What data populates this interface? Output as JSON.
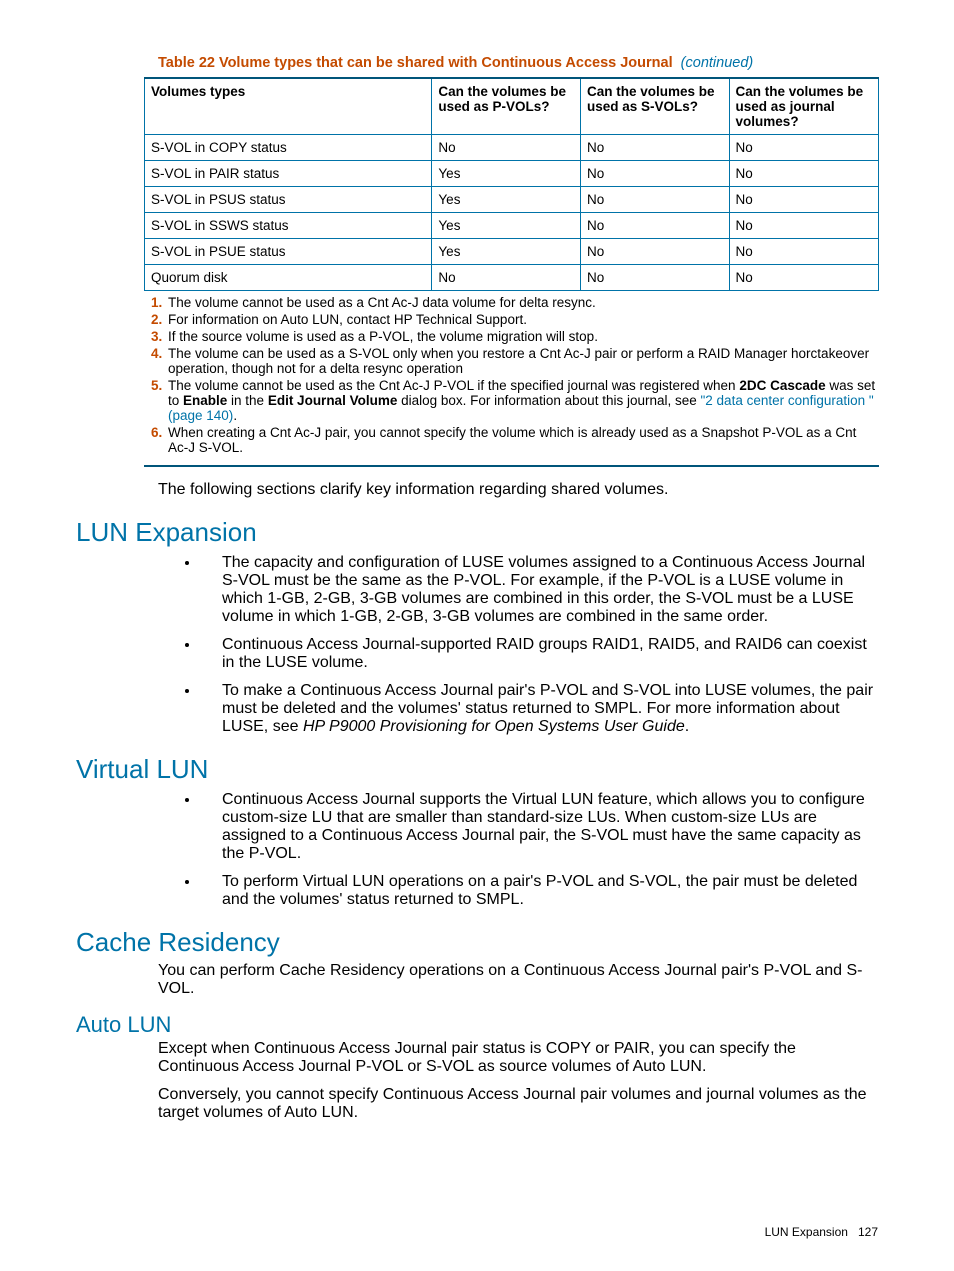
{
  "table": {
    "caption_prefix": "Table 22 Volume types that can be shared with Continuous Access Journal",
    "caption_suffix": "(continued)",
    "headers": [
      "Volumes types",
      "Can the volumes be used as P-VOLs?",
      "Can the volumes be used as S-VOLs?",
      "Can the volumes be used as journal volumes?"
    ],
    "rows": [
      [
        "S-VOL in COPY status",
        "No",
        "No",
        "No"
      ],
      [
        "S-VOL in PAIR status",
        "Yes",
        "No",
        "No"
      ],
      [
        "S-VOL in PSUS status",
        "Yes",
        "No",
        "No"
      ],
      [
        "S-VOL in SSWS status",
        "Yes",
        "No",
        "No"
      ],
      [
        "S-VOL in PSUE status",
        "Yes",
        "No",
        "No"
      ],
      [
        "Quorum disk",
        "No",
        "No",
        "No"
      ]
    ]
  },
  "footnotes": {
    "n1": "The volume cannot be used as a Cnt Ac-J data volume for delta resync.",
    "n2": "For information on Auto LUN, contact HP Technical Support.",
    "n3": "If the source volume is used as a P-VOL, the volume migration will stop.",
    "n4": "The volume can be used as a S-VOL only when you restore a Cnt Ac-J pair or perform a RAID Manager horctakeover operation, though not for a delta resync operation",
    "n5_a": "The volume cannot be used as the Cnt Ac-J P-VOL if the specified journal was registered when ",
    "n5_b": "2DC Cascade",
    "n5_c": " was set to ",
    "n5_d": "Enable",
    "n5_e": " in the ",
    "n5_f": "Edit Journal Volume",
    "n5_g": " dialog box. For information about this journal, see ",
    "n5_link": "\"2 data center configuration \" (page 140)",
    "n5_h": ".",
    "n6": "When creating a Cnt Ac-J pair, you cannot specify the volume which is already used as a Snapshot P-VOL as a Cnt Ac-J S-VOL."
  },
  "intro_p": "The following sections clarify key information regarding shared volumes.",
  "sections": {
    "lun_expansion": {
      "title": "LUN Expansion",
      "b1": "The capacity and configuration of LUSE volumes assigned to a Continuous Access Journal S-VOL must be the same as the P-VOL. For example, if the P-VOL is a LUSE volume in which 1-GB, 2-GB, 3-GB volumes are combined in this order, the S-VOL must be a LUSE volume in which 1-GB, 2-GB, 3-GB volumes are combined in the same order.",
      "b2": "Continuous Access Journal-supported RAID groups RAID1, RAID5, and RAID6 can coexist in the LUSE volume.",
      "b3_a": "To make a Continuous Access Journal pair's P-VOL and S-VOL into LUSE volumes, the pair must be deleted and the volumes' status returned to SMPL. For more information about LUSE, see ",
      "b3_i": "HP P9000 Provisioning for Open Systems User Guide",
      "b3_b": "."
    },
    "virtual_lun": {
      "title": "Virtual LUN",
      "b1": "Continuous Access Journal supports the Virtual LUN feature, which allows you to configure custom-size LU that are smaller than standard-size LUs. When custom-size LUs are assigned to a Continuous Access Journal pair, the S-VOL must have the same capacity as the P-VOL.",
      "b2": "To perform Virtual LUN operations on a pair's P-VOL and S-VOL, the pair must be deleted and the volumes' status returned to SMPL."
    },
    "cache_residency": {
      "title": "Cache Residency",
      "p1": "You can perform Cache Residency operations on a Continuous Access Journal pair's P-VOL and S-VOL."
    },
    "auto_lun": {
      "title": "Auto LUN",
      "p1": "Except when Continuous Access Journal pair status is COPY or PAIR, you can specify the Continuous Access Journal P-VOL or S-VOL as source volumes of Auto LUN.",
      "p2": "Conversely, you cannot specify Continuous Access Journal pair volumes and journal volumes as the target volumes of Auto LUN."
    }
  },
  "footer": {
    "section": "LUN Expansion",
    "page": "127"
  }
}
